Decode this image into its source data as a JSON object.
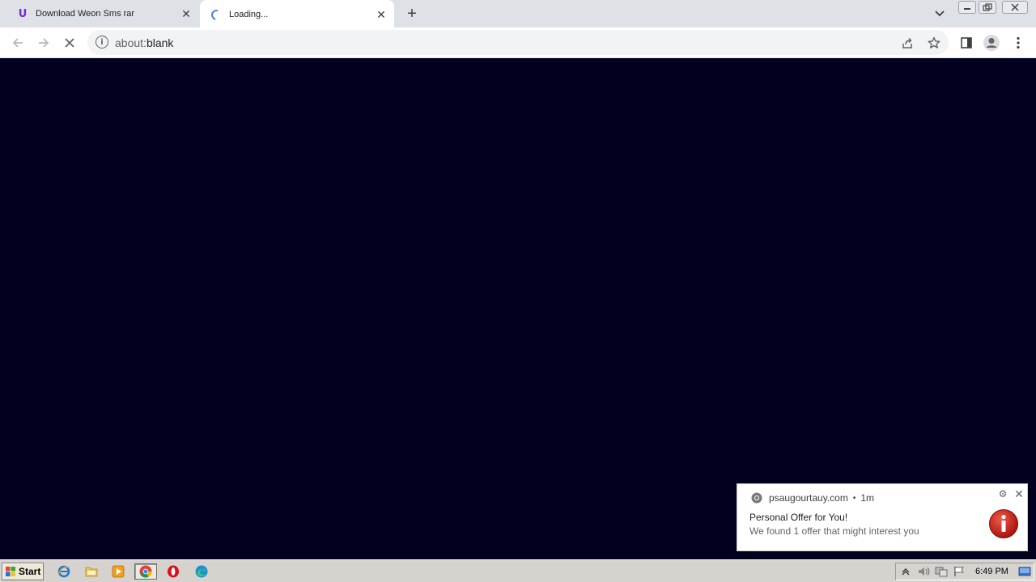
{
  "browser": {
    "tabs": [
      {
        "title": "Download Weon Sms rar",
        "favicon": "u-logo-icon",
        "state": "inactive"
      },
      {
        "title": "Loading...",
        "favicon": "loading-spinner-icon",
        "state": "active"
      }
    ],
    "new_tab_label": "+",
    "address": {
      "scheme": "about:",
      "host": "blank"
    },
    "favicon_letter": "U"
  },
  "content": {
    "background": "#02001f"
  },
  "notification": {
    "source": "psaugourtauy.com",
    "separator": "•",
    "age": "1m",
    "title": "Personal Offer for You!",
    "body": "We found 1 offer that might interest you",
    "image": "info-icon"
  },
  "taskbar": {
    "start_label": "Start",
    "clock": "6:49 PM",
    "quick_launch": [
      "ie-icon",
      "folder-icon",
      "media-player-icon",
      "chrome-icon",
      "opera-icon",
      "edge-icon"
    ]
  }
}
